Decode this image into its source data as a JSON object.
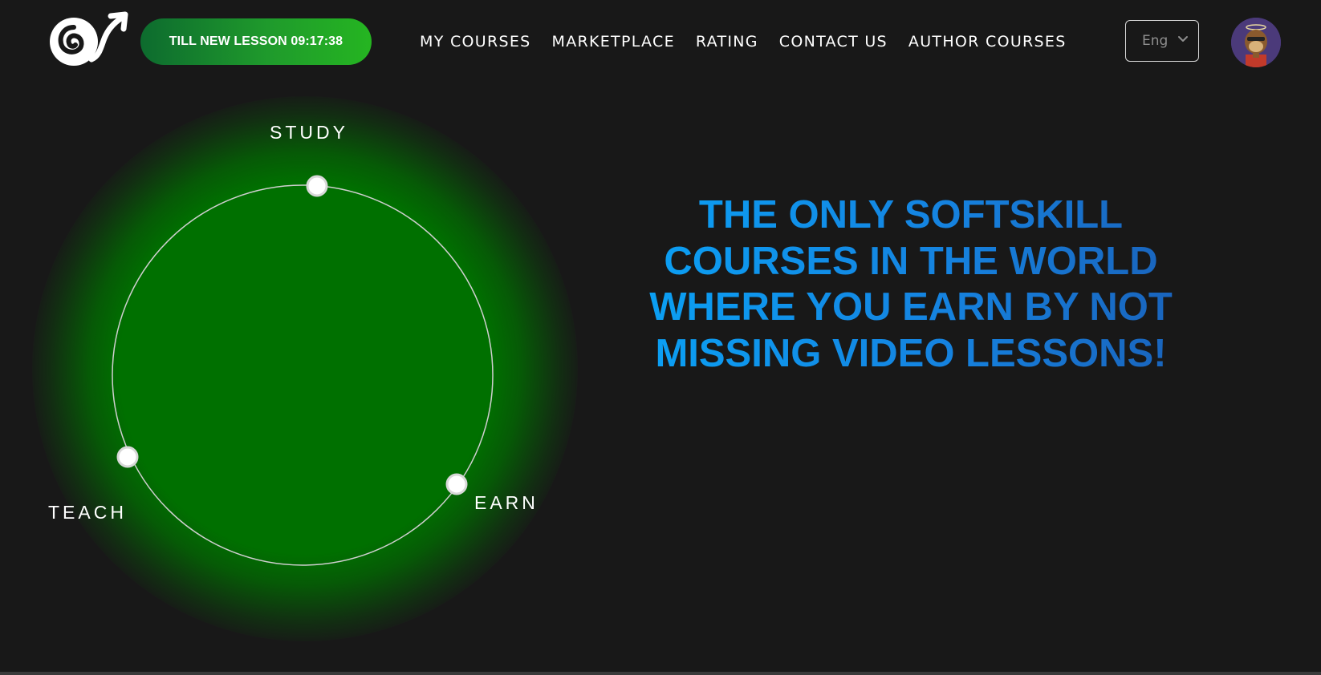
{
  "header": {
    "timer_label": "TILL NEW LESSON 09:17:38",
    "nav": [
      {
        "label": "MY COURSES"
      },
      {
        "label": "MARKETPLACE"
      },
      {
        "label": "RATING"
      },
      {
        "label": "CONTACT US"
      },
      {
        "label": "AUTHOR COURSES"
      }
    ],
    "language": {
      "selected": "Eng"
    }
  },
  "hero": {
    "cycle_labels": {
      "study": "STUDY",
      "teach": "TEACH",
      "earn": "EARN"
    },
    "headline_lines": [
      "THE ONLY SOFTSKILL",
      "COURSES IN THE WORLD",
      "WHERE YOU EARN BY NOT",
      "MISSING VIDEO LESSONS!"
    ]
  },
  "colors": {
    "background": "#181818",
    "circle_green": "#007000",
    "timer_gradient_start": "#0d6b2e",
    "timer_gradient_end": "#25b521",
    "headline_blue": "#1583e0"
  },
  "icons": {
    "logo": "spiral-arrow-logo",
    "language_chevron": "chevron-down-icon",
    "avatar": "ape-avatar"
  }
}
